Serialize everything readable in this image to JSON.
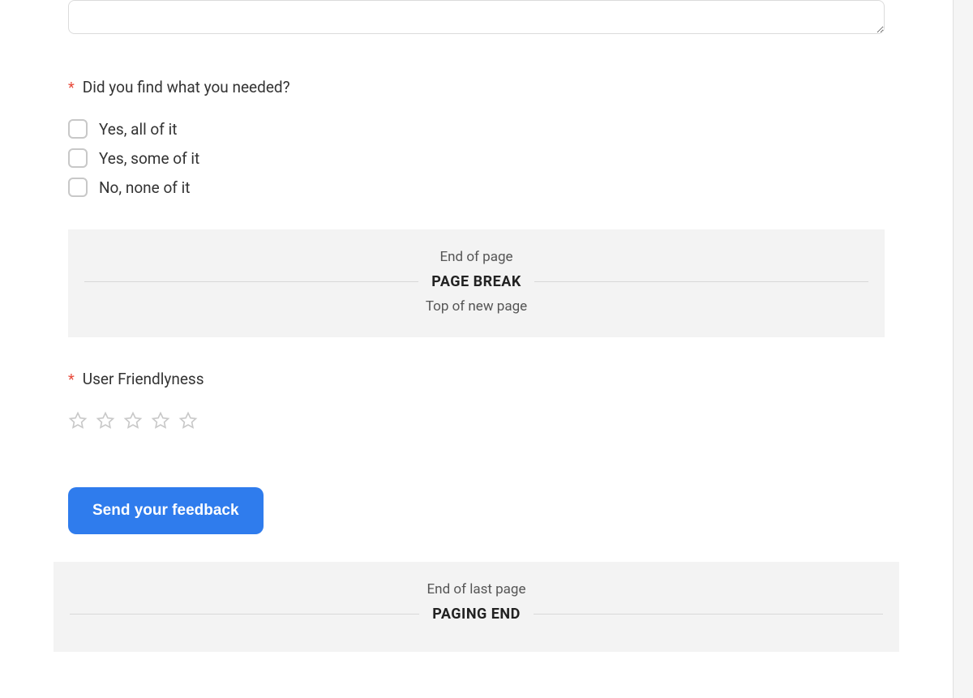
{
  "question1": {
    "label": "Did you find what you needed?",
    "options": [
      "Yes, all of it",
      "Yes, some of it",
      "No, none of it"
    ]
  },
  "pageBreak": {
    "topText": "End of page",
    "title": "PAGE BREAK",
    "bottomText": "Top of new page"
  },
  "question2": {
    "label": "User Friendlyness"
  },
  "submit": {
    "label": "Send your feedback"
  },
  "pagingEnd": {
    "topText": "End of last page",
    "title": "PAGING END"
  }
}
